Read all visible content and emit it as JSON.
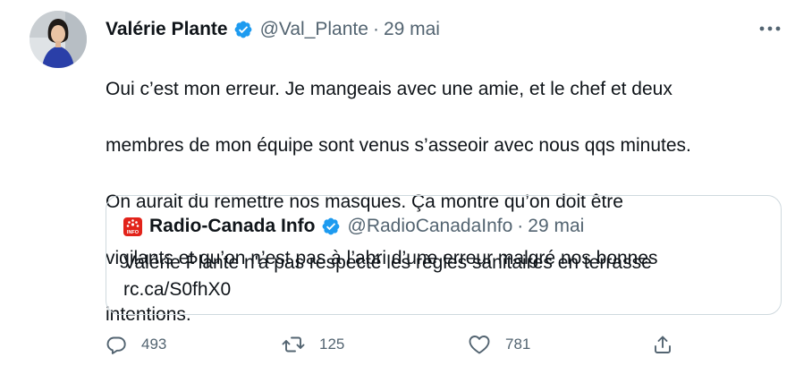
{
  "author": {
    "display_name": "Valérie Plante",
    "handle": "@Val_Plante",
    "separator": "·",
    "date": "29 mai"
  },
  "tweet": {
    "text_lines": [
      "Oui c’est mon erreur. Je mangeais avec une amie, et le chef et deux",
      "membres de mon équipe sont venus s’asseoir avec nous qqs minutes.",
      "On aurait du remettre nos masques. Ça montre qu’on doit être",
      "vigilants et qu’on n’est pas à l’abri d’une erreur malgré nos bonnes",
      "intentions."
    ]
  },
  "quoted": {
    "display_name": "Radio-Canada Info",
    "handle": "@RadioCanadaInfo",
    "separator": "·",
    "date": "29 mai",
    "text": "Valérie Plante n'a pas respecté les règles sanitaires en terrasse",
    "link": "rc.ca/S0fhX0",
    "logo_label": "INFO"
  },
  "actions": {
    "reply": {
      "icon": "reply-icon",
      "count": "493"
    },
    "retweet": {
      "icon": "retweet-icon",
      "count": "125"
    },
    "like": {
      "icon": "heart-icon",
      "count": "781"
    },
    "share": {
      "icon": "share-icon"
    }
  },
  "colors": {
    "verified": "#1d9bf0",
    "muted": "#536471",
    "text": "#0f1419",
    "border": "#cfd9de",
    "radio_canada_red": "#e2231a"
  }
}
